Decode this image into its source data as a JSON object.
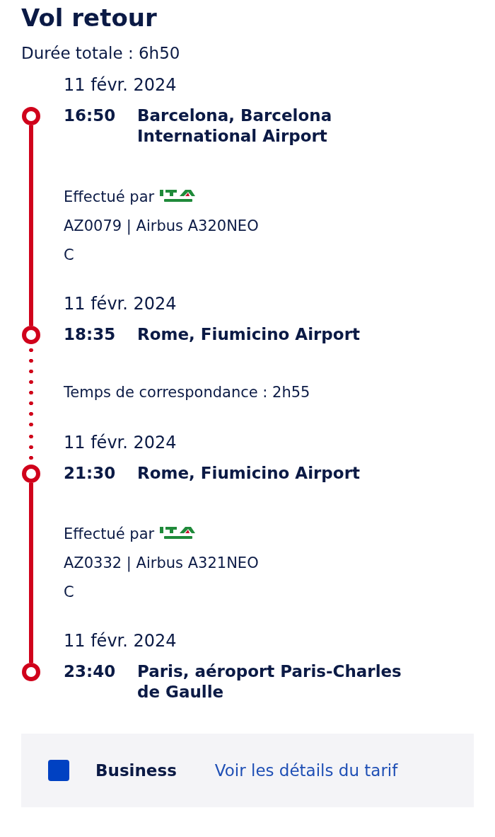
{
  "title": "Vol retour",
  "total_duration": "Durée totale : 6h50",
  "legs": [
    {
      "kind": "flight",
      "departure": {
        "date": "11 févr. 2024",
        "time": "16:50",
        "place": "Barcelona, Barcelona International Airport"
      },
      "operated_by": "Effectué par",
      "flight": "AZ0079 | Airbus A320NEO",
      "cabin": "C",
      "arrival": {
        "date": "11 févr. 2024",
        "time": "18:35",
        "place": "Rome, Fiumicino Airport"
      }
    },
    {
      "kind": "connection",
      "text": "Temps de correspondance : 2h55"
    },
    {
      "kind": "flight",
      "departure": {
        "date": "11 févr. 2024",
        "time": "21:30",
        "place": "Rome, Fiumicino Airport"
      },
      "operated_by": "Effectué par",
      "flight": "AZ0332 | Airbus A321NEO",
      "cabin": "C",
      "arrival": {
        "date": "11 févr. 2024",
        "time": "23:40",
        "place": "Paris, aéroport Paris-Charles de Gaulle"
      }
    }
  ],
  "fare": {
    "cabin": "Business",
    "link": "Voir les détails du tarif"
  }
}
